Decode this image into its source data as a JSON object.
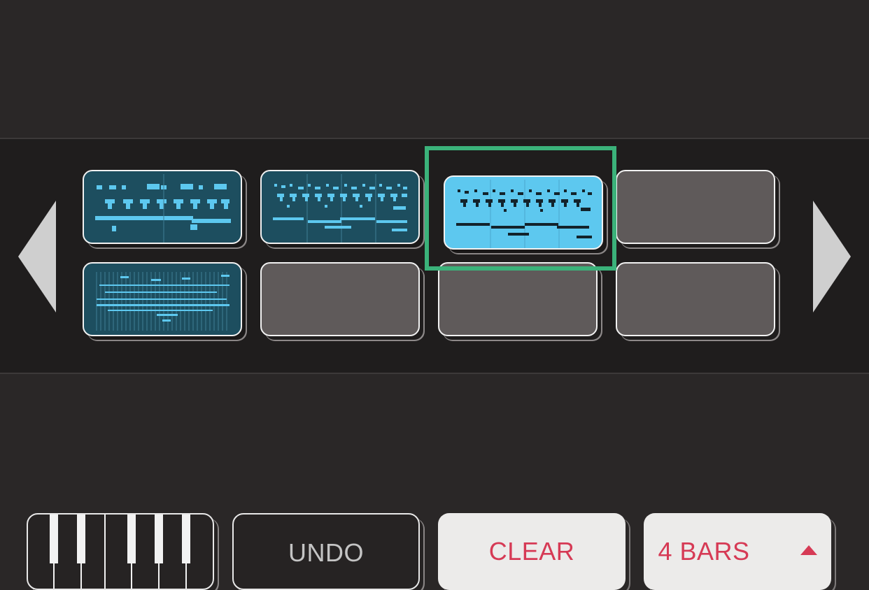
{
  "navigation": {
    "prev_icon": "triangle-left-icon",
    "next_icon": "triangle-right-icon"
  },
  "patterns": {
    "rows": 2,
    "columns": 4,
    "selected_index": 2,
    "pads": [
      {
        "row": 1,
        "column": 1,
        "state": "filled"
      },
      {
        "row": 1,
        "column": 2,
        "state": "filled"
      },
      {
        "row": 1,
        "column": 3,
        "state": "selected"
      },
      {
        "row": 1,
        "column": 4,
        "state": "empty"
      },
      {
        "row": 2,
        "column": 1,
        "state": "filled"
      },
      {
        "row": 2,
        "column": 2,
        "state": "empty"
      },
      {
        "row": 2,
        "column": 3,
        "state": "empty"
      },
      {
        "row": 2,
        "column": 4,
        "state": "empty"
      }
    ]
  },
  "colors": {
    "background": "#2a2727",
    "band": "#1f1d1d",
    "pad_filled": "#1d4e5f",
    "pad_selected": "#5dc8ef",
    "note_light": "#5dc8ef",
    "note_dark": "#13232b",
    "selection_frame": "#3bb27a",
    "accent_red": "#d63a55"
  },
  "toolbar": {
    "keyboard_icon": "piano-keys-icon",
    "undo_label": "UNDO",
    "clear_label": "CLEAR",
    "bars_label": "4 BARS",
    "bars_icon": "caret-up-icon"
  }
}
